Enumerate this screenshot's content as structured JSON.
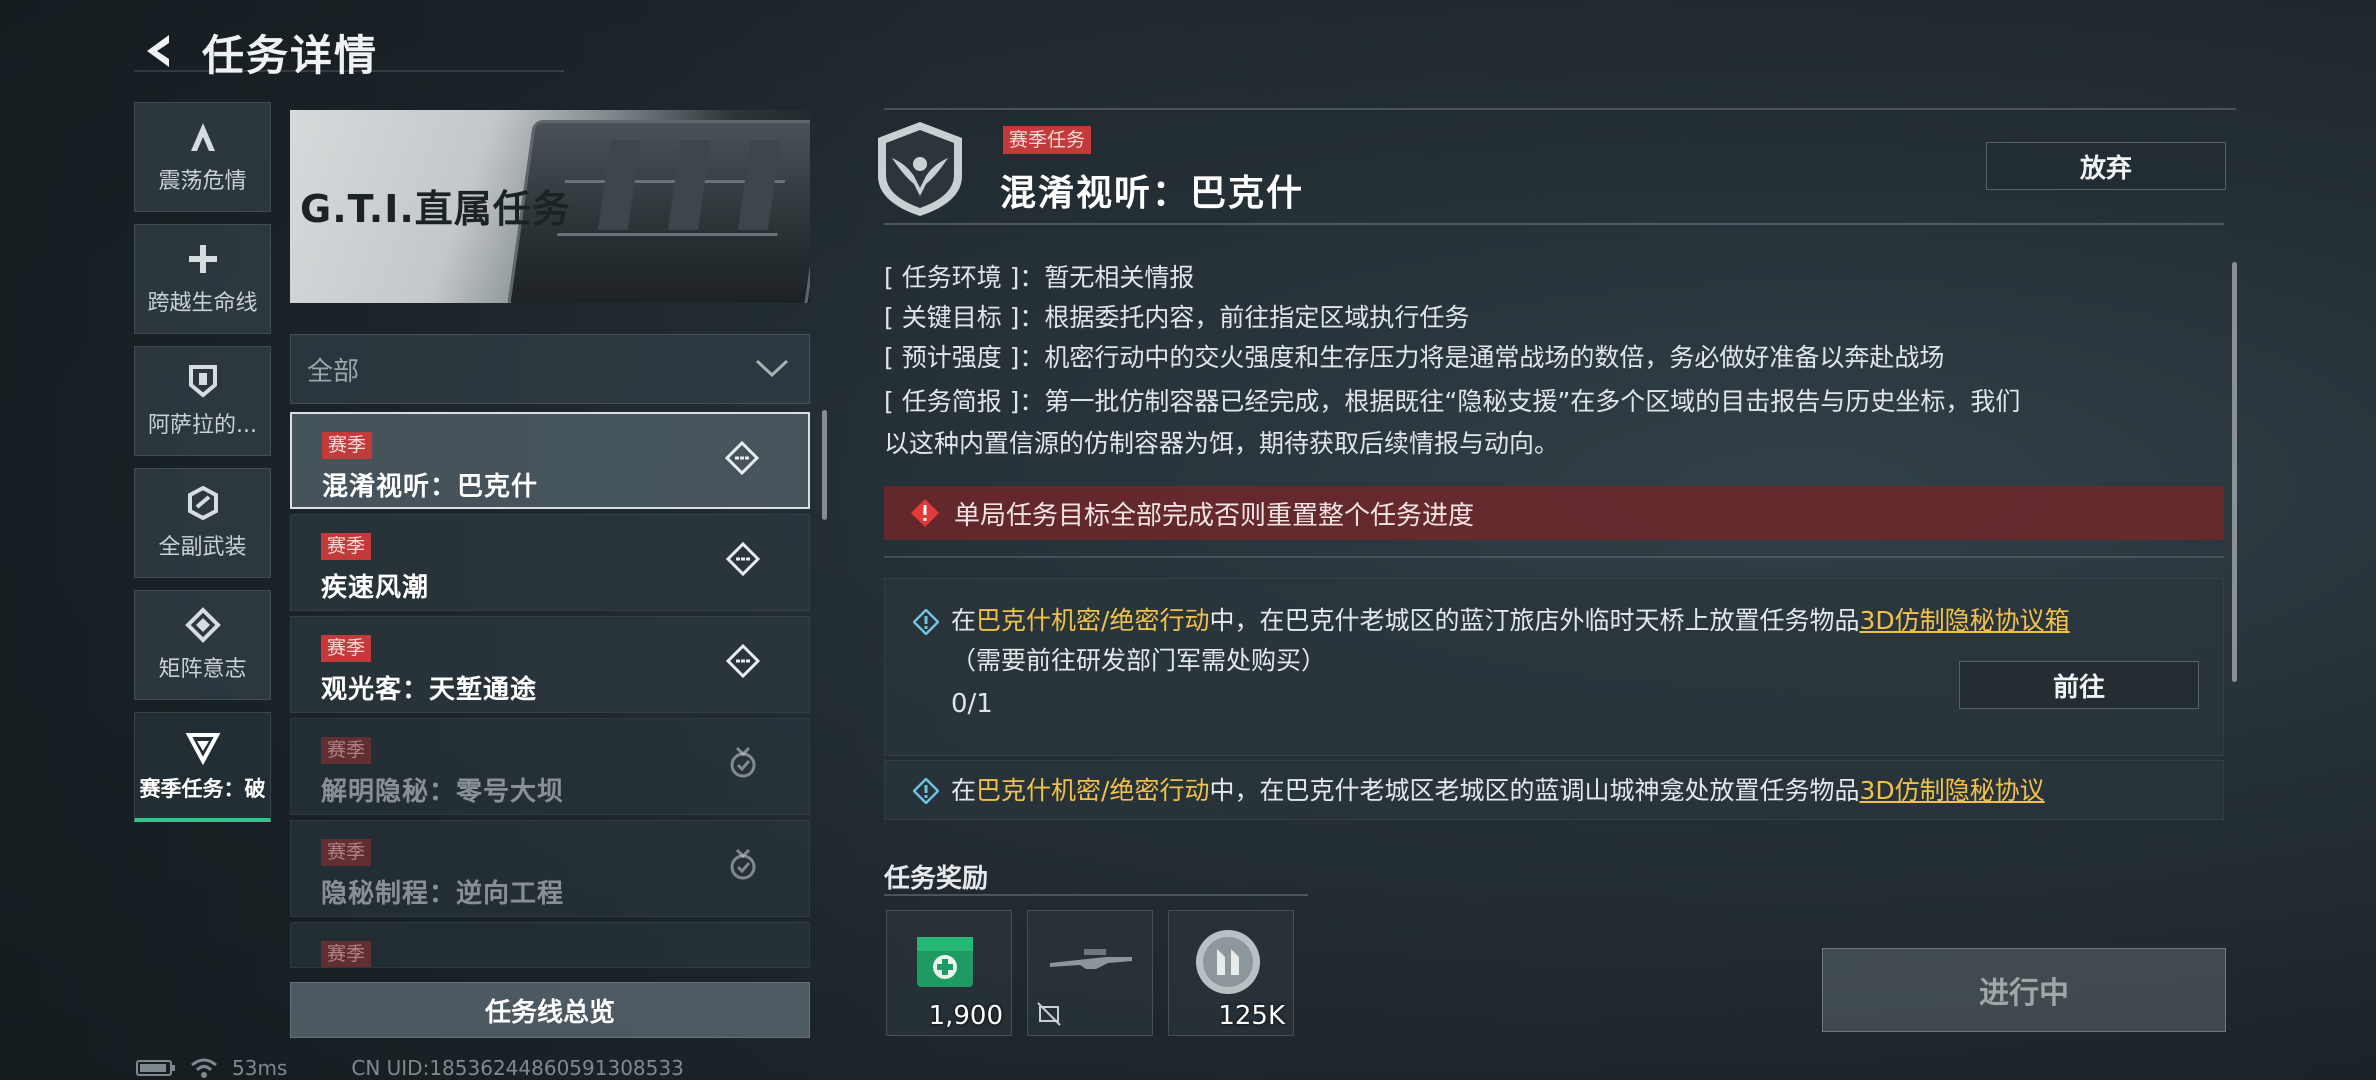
{
  "header": {
    "title": "任务详情"
  },
  "nav": [
    {
      "label": "震荡危情",
      "icon": "tripod-icon"
    },
    {
      "label": "跨越生命线",
      "icon": "cross-icon"
    },
    {
      "label": "阿萨拉的...",
      "icon": "shield-icon"
    },
    {
      "label": "全副武装",
      "icon": "hexagon-icon"
    },
    {
      "label": "矩阵意志",
      "icon": "diamond-icon"
    },
    {
      "label": "赛季任务：破",
      "icon": "triangle-icon",
      "active": true
    }
  ],
  "banner": {
    "title": "G.T.I.直属任务"
  },
  "filter": {
    "value": "全部"
  },
  "tasks": [
    {
      "tag": "赛季",
      "name": "混淆视听：巴克什",
      "state": "active",
      "selected": true
    },
    {
      "tag": "赛季",
      "name": "疾速风潮",
      "state": "active"
    },
    {
      "tag": "赛季",
      "name": "观光客：天堑通途",
      "state": "active"
    },
    {
      "tag": "赛季",
      "name": "解明隐秘：零号大坝",
      "state": "done"
    },
    {
      "tag": "赛季",
      "name": "隐秘制程：逆向工程",
      "state": "done"
    },
    {
      "tag": "赛季",
      "name": "",
      "state": "done"
    }
  ],
  "overview_button": "任务线总览",
  "status_bar": {
    "latency": "53ms",
    "uid": "CN UID:18536244860591308533"
  },
  "detail": {
    "tag": "赛季任务",
    "title": "混淆视听：巴克什",
    "abandon": "放弃",
    "info": [
      {
        "key": "[ 任务环境 ]：",
        "value": "暂无相关情报"
      },
      {
        "key": "[ 关键目标 ]：",
        "value": "根据委托内容，前往指定区域执行任务"
      },
      {
        "key": "[ 预计强度 ]：",
        "value": "机密行动中的交火强度和生存压力将是通常战场的数倍，务必做好准备以奔赴战场"
      },
      {
        "key": "[ 任务简报 ]：",
        "value": "第一批仿制容器已经完成，根据既往“隐秘支援”在多个区域的目击报告与历史坐标，我们"
      }
    ],
    "info_cont": "以这种内置信源的仿制容器为饵，期待获取后续情报与动向。",
    "warning": "单局任务目标全部完成否则重置整个任务进度",
    "objectives": [
      {
        "pre": "在",
        "hl1": "巴克什机密/绝密行动",
        "mid": "中，在巴克什老城区的蓝汀旅店外临时天桥上放置任务物品",
        "item": "3D仿制隐秘协议箱",
        "post": "（需要前往研发部门军需处购买）",
        "progress": "0/1",
        "button": "前往"
      },
      {
        "pre": "在",
        "hl1": "巴克什机密/绝密行动",
        "mid": "中，在巴克什老城区老城区的蓝调山城神龛处放置任务物品",
        "item": "3D仿制隐秘协议",
        "post": ""
      }
    ],
    "reward_title": "任务奖励",
    "rewards": [
      {
        "amount": "1,900",
        "icon": "medkit-icon"
      },
      {
        "amount": "",
        "icon": "rifle-icon"
      },
      {
        "amount": "125K",
        "icon": "coin-icon"
      }
    ],
    "status_button": "进行中"
  },
  "colors": {
    "accent_green": "#35c48d",
    "tag_red": "#c23a3a",
    "highlight": "#f2c14b",
    "warning_bg": "#782428"
  }
}
